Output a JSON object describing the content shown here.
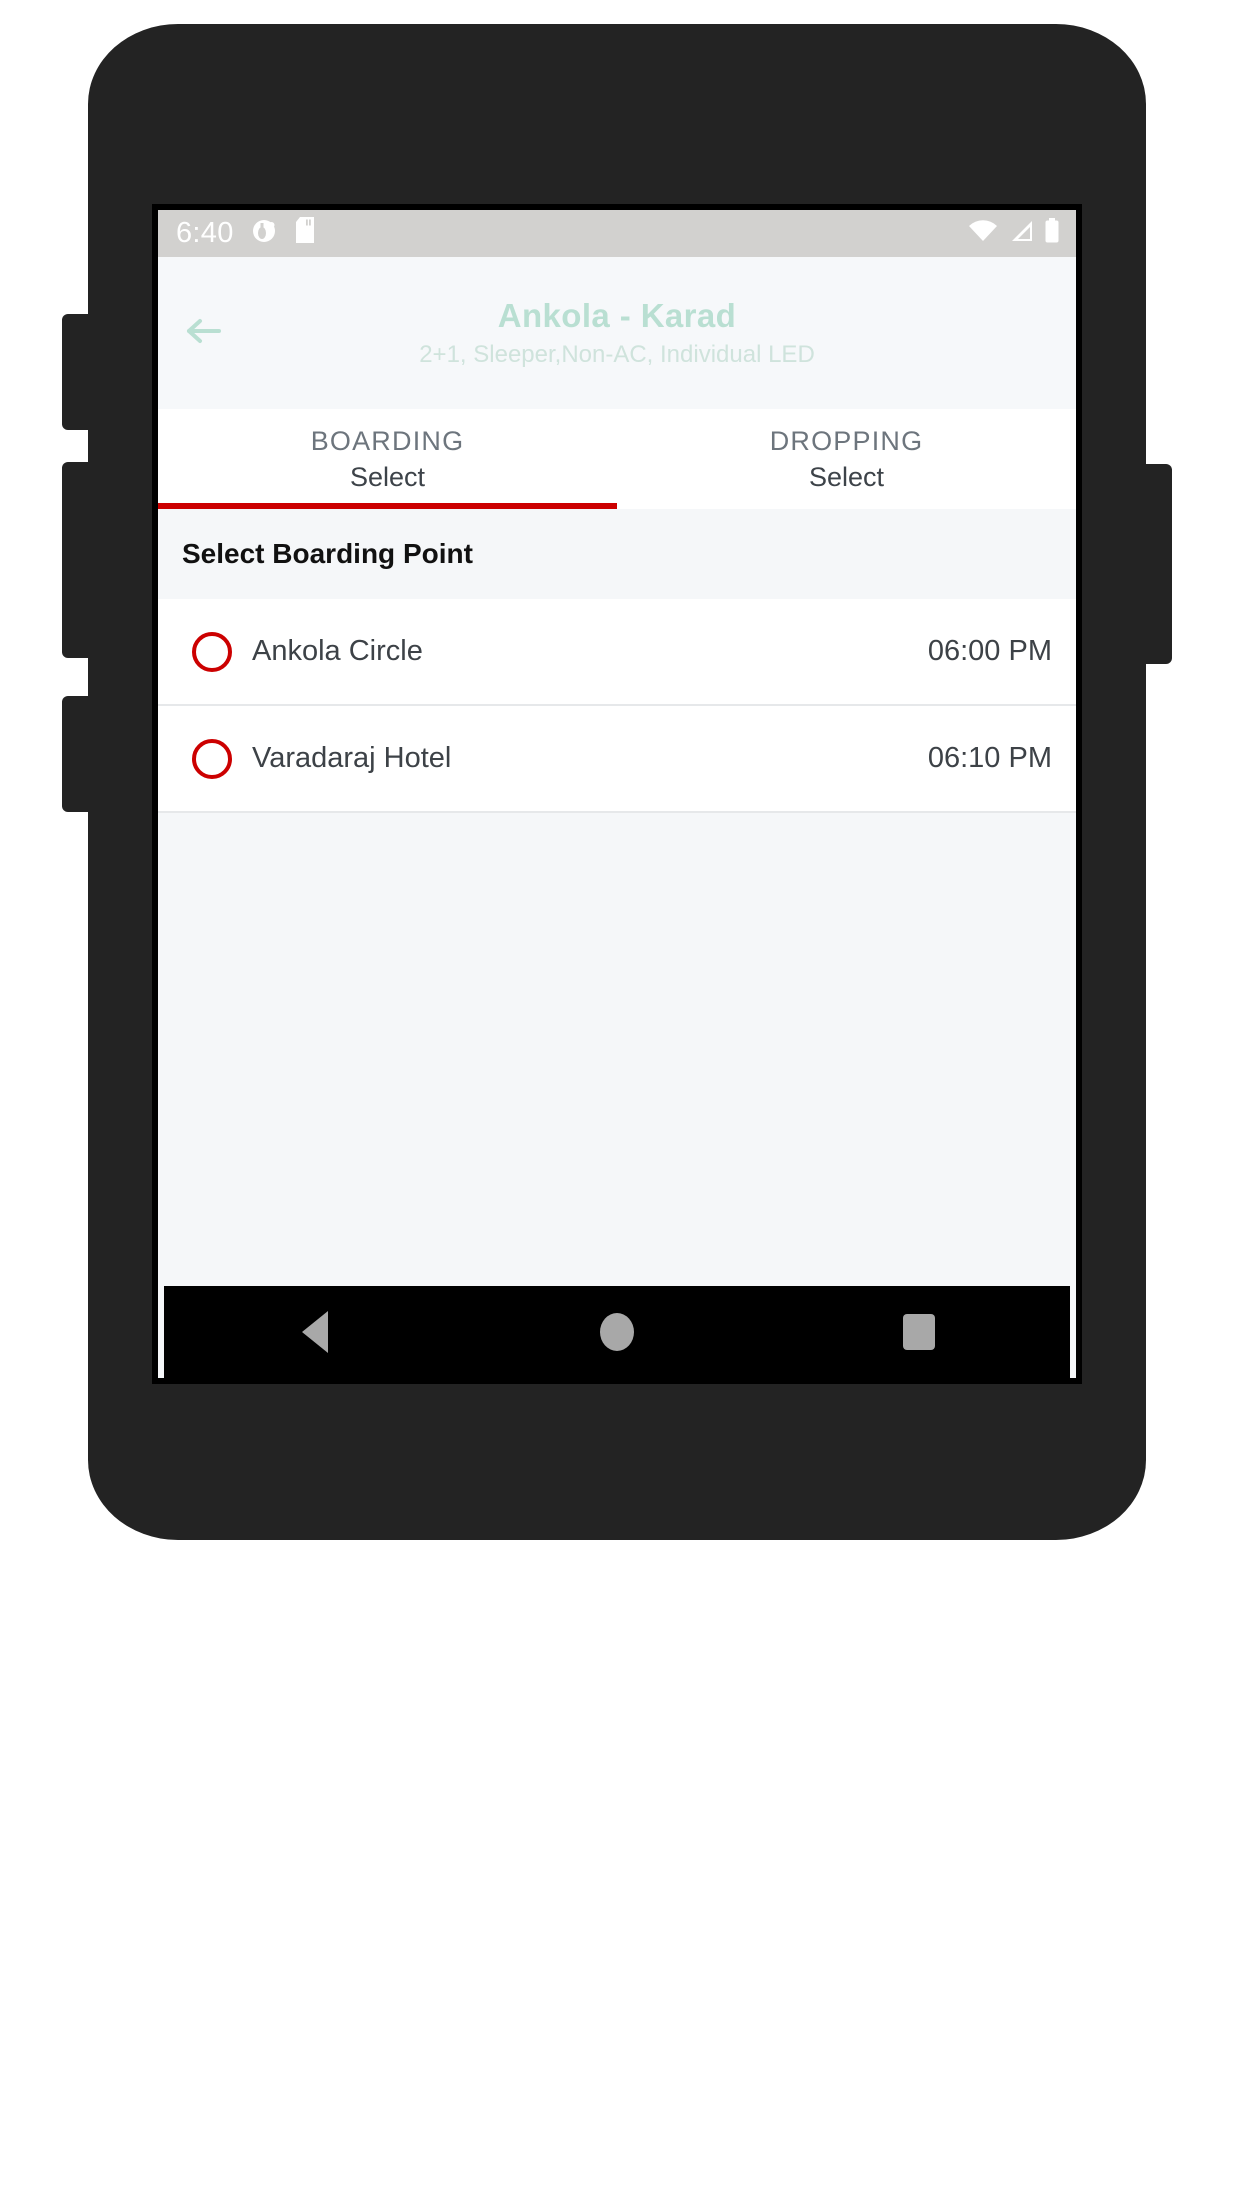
{
  "status_bar": {
    "clock": "6:40",
    "left_icons": [
      "app-notification-icon",
      "sd-card-icon"
    ],
    "right_icons": [
      "wifi-icon",
      "cellular-signal-icon",
      "battery-icon"
    ]
  },
  "app_bar": {
    "back_icon": "back-arrow-icon",
    "title": "Ankola - Karad",
    "subtitle": "2+1, Sleeper,Non-AC, Individual LED",
    "title_color": "#b9dfd2",
    "background": "#f6f8fa"
  },
  "tabs": {
    "active_index": 0,
    "indicator_color": "#cc0000",
    "items": [
      {
        "label": "BOARDING",
        "value": "Select"
      },
      {
        "label": "DROPPING",
        "value": "Select"
      }
    ]
  },
  "section": {
    "header": "Select Boarding Point"
  },
  "boarding_points": [
    {
      "name": "Ankola Circle",
      "time": "06:00 PM",
      "selected": false
    },
    {
      "name": "Varadaraj Hotel",
      "time": "06:10 PM",
      "selected": false
    }
  ],
  "nav_bar": {
    "buttons": [
      "back-triangle-icon",
      "home-circle-icon",
      "recents-square-icon"
    ]
  },
  "colors": {
    "accent_red": "#cc0000",
    "screen_background": "#f5f7f9",
    "card_background": "#ffffff"
  }
}
